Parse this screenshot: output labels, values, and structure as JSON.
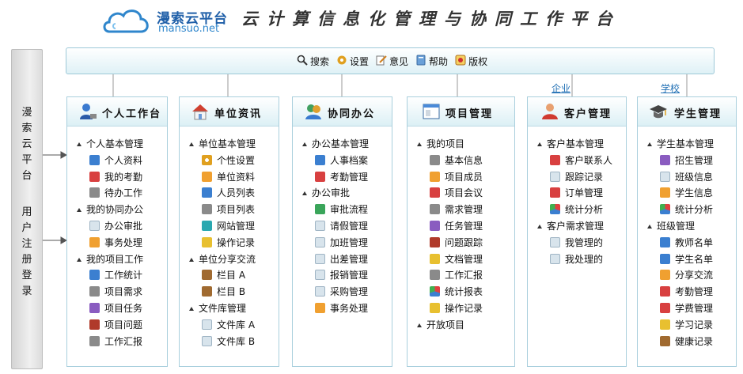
{
  "logo": {
    "cn": "漫索云平台",
    "en": "mansuo.net"
  },
  "slogan": "云计算信息化管理与协同工作平台",
  "left_strip": {
    "top": [
      "漫",
      "索",
      "云",
      "平",
      "台"
    ],
    "bottom": [
      "用",
      "户",
      "注",
      "册",
      "登",
      "录"
    ]
  },
  "toolbar": [
    {
      "label": "搜索",
      "icon": "search-icon"
    },
    {
      "label": "设置",
      "icon": "gear-icon"
    },
    {
      "label": "意见",
      "icon": "pencil-icon"
    },
    {
      "label": "帮助",
      "icon": "help-icon"
    },
    {
      "label": "版权",
      "icon": "copyright-icon"
    }
  ],
  "tags": {
    "enterprise": "企业",
    "school": "学校"
  },
  "columns": [
    {
      "title": "个人工作台",
      "icon": "user-desk-icon",
      "rows": [
        {
          "t": "s",
          "label": "个人基本管理"
        },
        {
          "t": "i",
          "label": "个人资料",
          "icon": "i-blue"
        },
        {
          "t": "i",
          "label": "我的考勤",
          "icon": "i-red"
        },
        {
          "t": "i",
          "label": "待办工作",
          "icon": "i-gray"
        },
        {
          "t": "s",
          "label": "我的协同办公"
        },
        {
          "t": "i",
          "label": "办公审批",
          "icon": "i-pale"
        },
        {
          "t": "i",
          "label": "事务处理",
          "icon": "i-orange"
        },
        {
          "t": "s",
          "label": "我的项目工作"
        },
        {
          "t": "i",
          "label": "工作统计",
          "icon": "i-blue"
        },
        {
          "t": "i",
          "label": "项目需求",
          "icon": "i-gray"
        },
        {
          "t": "i",
          "label": "项目任务",
          "icon": "i-purple"
        },
        {
          "t": "i",
          "label": "项目问题",
          "icon": "i-bug"
        },
        {
          "t": "i",
          "label": "工作汇报",
          "icon": "i-gray"
        }
      ]
    },
    {
      "title": "单位资讯",
      "icon": "home-icon",
      "rows": [
        {
          "t": "s",
          "label": "单位基本管理"
        },
        {
          "t": "i",
          "label": "个性设置",
          "icon": "i-gear"
        },
        {
          "t": "i",
          "label": "单位资料",
          "icon": "i-orange"
        },
        {
          "t": "i",
          "label": "人员列表",
          "icon": "i-blue"
        },
        {
          "t": "i",
          "label": "项目列表",
          "icon": "i-gray"
        },
        {
          "t": "i",
          "label": "网站管理",
          "icon": "i-teal"
        },
        {
          "t": "i",
          "label": "操作记录",
          "icon": "i-yellow"
        },
        {
          "t": "s",
          "label": "单位分享交流"
        },
        {
          "t": "i",
          "label": "栏目 A",
          "icon": "i-brown"
        },
        {
          "t": "i",
          "label": "栏目 B",
          "icon": "i-brown"
        },
        {
          "t": "s",
          "label": "文件库管理"
        },
        {
          "t": "i",
          "label": "文件库 A",
          "icon": "i-pale"
        },
        {
          "t": "i",
          "label": "文件库 B",
          "icon": "i-pale"
        }
      ]
    },
    {
      "title": "协同办公",
      "icon": "collab-icon",
      "rows": [
        {
          "t": "s",
          "label": "办公基本管理"
        },
        {
          "t": "i",
          "label": "人事档案",
          "icon": "i-blue"
        },
        {
          "t": "i",
          "label": "考勤管理",
          "icon": "i-red"
        },
        {
          "t": "s",
          "label": "办公审批"
        },
        {
          "t": "i",
          "label": "审批流程",
          "icon": "i-green"
        },
        {
          "t": "i",
          "label": "请假管理",
          "icon": "i-pale"
        },
        {
          "t": "i",
          "label": "加班管理",
          "icon": "i-pale"
        },
        {
          "t": "i",
          "label": "出差管理",
          "icon": "i-pale"
        },
        {
          "t": "i",
          "label": "报销管理",
          "icon": "i-pale"
        },
        {
          "t": "i",
          "label": "采购管理",
          "icon": "i-pale"
        },
        {
          "t": "i",
          "label": "事务处理",
          "icon": "i-orange"
        }
      ]
    },
    {
      "title": "项目管理",
      "icon": "window-icon",
      "rows": [
        {
          "t": "s",
          "label": "我的项目"
        },
        {
          "t": "i",
          "label": "基本信息",
          "icon": "i-gray"
        },
        {
          "t": "i",
          "label": "项目成员",
          "icon": "i-orange"
        },
        {
          "t": "i",
          "label": "项目会议",
          "icon": "i-red"
        },
        {
          "t": "i",
          "label": "需求管理",
          "icon": "i-gray"
        },
        {
          "t": "i",
          "label": "任务管理",
          "icon": "i-purple"
        },
        {
          "t": "i",
          "label": "问题跟踪",
          "icon": "i-bug"
        },
        {
          "t": "i",
          "label": "文档管理",
          "icon": "i-yellow"
        },
        {
          "t": "i",
          "label": "工作汇报",
          "icon": "i-gray"
        },
        {
          "t": "i",
          "label": "统计报表",
          "icon": "i-pie"
        },
        {
          "t": "i",
          "label": "操作记录",
          "icon": "i-yellow"
        },
        {
          "t": "s",
          "label": "开放项目"
        }
      ]
    },
    {
      "title": "客户管理",
      "icon": "customer-icon",
      "rows": [
        {
          "t": "s",
          "label": "客户基本管理"
        },
        {
          "t": "i",
          "label": "客户联系人",
          "icon": "i-red"
        },
        {
          "t": "i",
          "label": "跟踪记录",
          "icon": "i-pale"
        },
        {
          "t": "i",
          "label": "订单管理",
          "icon": "i-red"
        },
        {
          "t": "i",
          "label": "统计分析",
          "icon": "i-pie"
        },
        {
          "t": "s",
          "label": "客户需求管理"
        },
        {
          "t": "i",
          "label": "我管理的",
          "icon": "i-pale"
        },
        {
          "t": "i",
          "label": "我处理的",
          "icon": "i-pale"
        }
      ]
    },
    {
      "title": "学生管理",
      "icon": "graduate-icon",
      "rows": [
        {
          "t": "s",
          "label": "学生基本管理"
        },
        {
          "t": "i",
          "label": "招生管理",
          "icon": "i-purple"
        },
        {
          "t": "i",
          "label": "班级信息",
          "icon": "i-pale"
        },
        {
          "t": "i",
          "label": "学生信息",
          "icon": "i-orange"
        },
        {
          "t": "i",
          "label": "统计分析",
          "icon": "i-pie"
        },
        {
          "t": "s",
          "label": "班级管理"
        },
        {
          "t": "i",
          "label": "教师名单",
          "icon": "i-blue"
        },
        {
          "t": "i",
          "label": "学生名单",
          "icon": "i-blue"
        },
        {
          "t": "i",
          "label": "分享交流",
          "icon": "i-orange"
        },
        {
          "t": "i",
          "label": "考勤管理",
          "icon": "i-red"
        },
        {
          "t": "i",
          "label": "学费管理",
          "icon": "i-red"
        },
        {
          "t": "i",
          "label": "学习记录",
          "icon": "i-yellow"
        },
        {
          "t": "i",
          "label": "健康记录",
          "icon": "i-brown"
        }
      ]
    }
  ]
}
